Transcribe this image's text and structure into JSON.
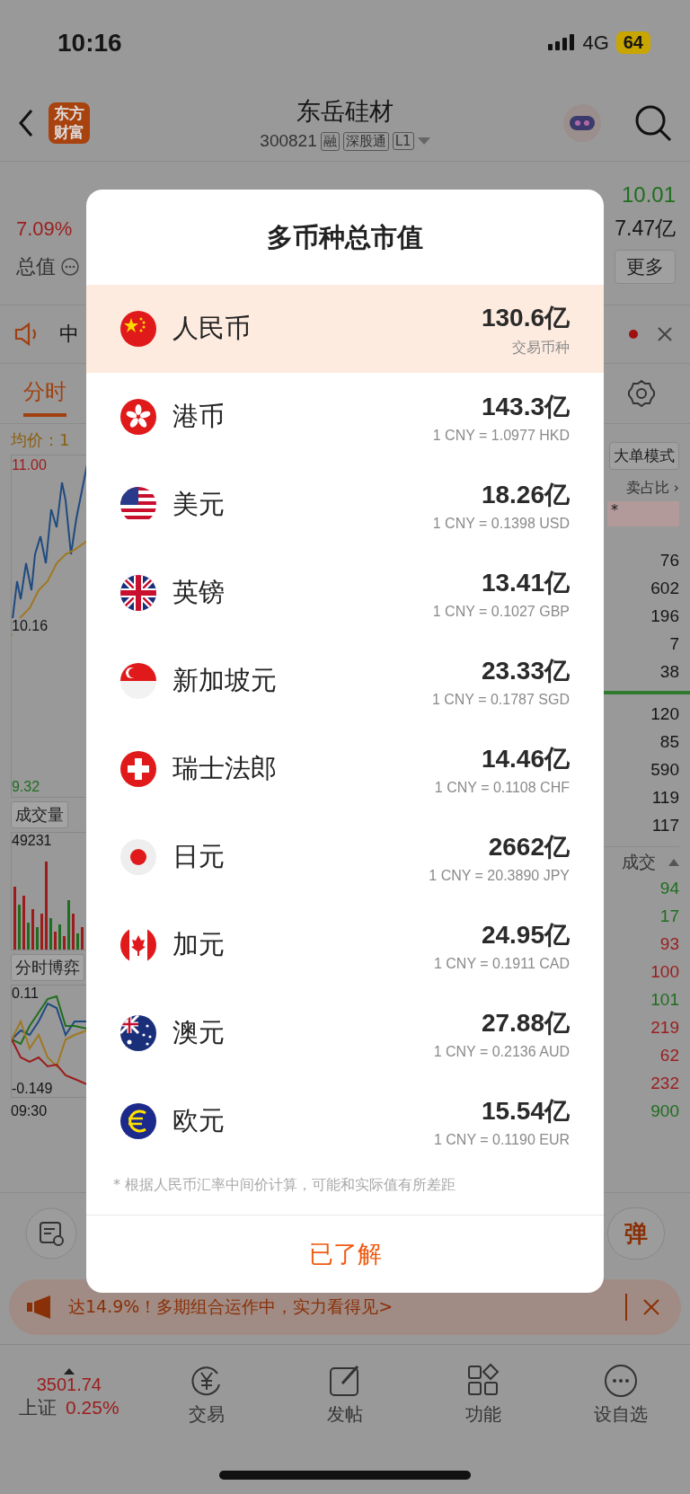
{
  "status_bar": {
    "time": "10:16",
    "network": "4G",
    "battery": "64"
  },
  "header": {
    "logo": "东方财富",
    "title": "东岳硅材",
    "code": "300821",
    "badges": [
      "融",
      "深股通",
      "L1"
    ]
  },
  "quote": {
    "low": "10.01",
    "change_pct": "7.09%",
    "turnover": "7.47亿",
    "total_value_label": "总值",
    "more_button": "更多"
  },
  "notice": {
    "text": "中"
  },
  "tabs": [
    {
      "label": "分时",
      "selected": true
    }
  ],
  "left_panel": {
    "avg_price": "均价：1",
    "price_high": "11.00",
    "price_ref": "10.16",
    "price_low": "9.32",
    "volume_button": "成交量",
    "volume_max": "49231",
    "game_button": "分时博弈",
    "game_high": "0.11",
    "game_low": "-0.149",
    "time_start": "09:30"
  },
  "right_panel": {
    "mode_button": "大单模式",
    "ratio_link": "卖占比 ›",
    "ratio_value": "*",
    "asks": [
      "76",
      "602",
      "196",
      "7",
      "38"
    ],
    "bids": [
      "120",
      "85",
      "590",
      "119",
      "117"
    ],
    "trades_header": "成交",
    "trades": [
      {
        "volume": "94",
        "color": "#1f6e1f"
      },
      {
        "volume": "17",
        "color": "#1f6e1f"
      },
      {
        "volume": "93",
        "color": "#9c1c1c"
      },
      {
        "volume": "100",
        "color": "#9c1c1c"
      },
      {
        "volume": "101",
        "color": "#1f6e1f"
      },
      {
        "volume": "219",
        "color": "#9c1c1c"
      },
      {
        "volume": "62",
        "color": "#9c1c1c"
      },
      {
        "volume": "232",
        "color": "#9c1c1c"
      },
      {
        "volume": "900",
        "color": "#1f6e1f"
      }
    ]
  },
  "modal": {
    "title": "多币种总市值",
    "rows": [
      {
        "currency": "人民币",
        "value": "130.6亿",
        "note": "交易币种",
        "selected": true
      },
      {
        "currency": "港币",
        "value": "143.3亿",
        "note": "1 CNY = 1.0977 HKD",
        "selected": false
      },
      {
        "currency": "美元",
        "value": "18.26亿",
        "note": "1 CNY = 0.1398 USD",
        "selected": false
      },
      {
        "currency": "英镑",
        "value": "13.41亿",
        "note": "1 CNY = 0.1027 GBP",
        "selected": false
      },
      {
        "currency": "新加坡元",
        "value": "23.33亿",
        "note": "1 CNY = 0.1787 SGD",
        "selected": false
      },
      {
        "currency": "瑞士法郎",
        "value": "14.46亿",
        "note": "1 CNY = 0.1108 CHF",
        "selected": false
      },
      {
        "currency": "日元",
        "value": "2662亿",
        "note": "1 CNY = 20.3890 JPY",
        "selected": false
      },
      {
        "currency": "加元",
        "value": "24.95亿",
        "note": "1 CNY = 0.1911 CAD",
        "selected": false
      },
      {
        "currency": "澳元",
        "value": "27.88亿",
        "note": "1 CNY = 0.2136 AUD",
        "selected": false
      },
      {
        "currency": "欧元",
        "value": "15.54亿",
        "note": "1 CNY = 0.1190 EUR",
        "selected": false
      }
    ],
    "footnote": "* 根据人民币汇率中间价计算，可能和实际值有所差距",
    "confirm_button": "已了解"
  },
  "toolbar": {
    "bullet_button": "弹"
  },
  "banner": {
    "text": "达14.9%！多期组合运作中，实力看得见>"
  },
  "bottom_nav": {
    "index_value": "3501.74",
    "index_name": "上证",
    "index_change": "0.25%",
    "items": [
      "交易",
      "发帖",
      "功能",
      "设自选"
    ]
  }
}
